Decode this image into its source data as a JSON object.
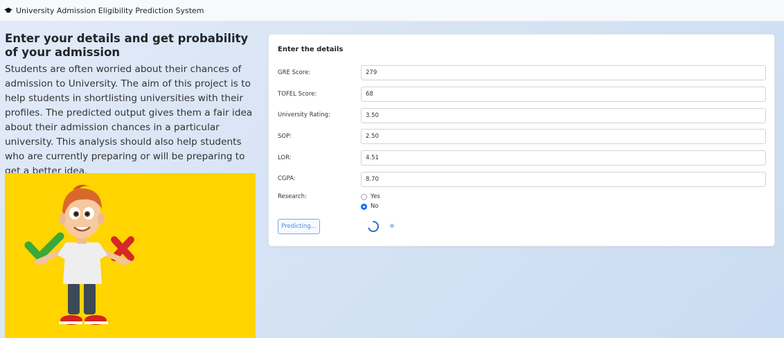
{
  "navbar": {
    "title": "University Admission Eligibility Prediction System",
    "icon": "graduation-cap-icon"
  },
  "intro": {
    "headline": "Enter your details and get probability of your admission",
    "description": "Students are often worried about their chances of admission to University. The aim of this project is to help students in shortlisting universities with their profiles. The predicted output gives them a fair idea about their admission chances in a particular university. This analysis should also help students who are currently preparing or will be preparing to get a better idea."
  },
  "form": {
    "title": "Enter the details",
    "fields": {
      "gre": {
        "label": "GRE Score:",
        "value": "279"
      },
      "tofel": {
        "label": "TOFEL Score:",
        "value": "68"
      },
      "rating": {
        "label": "University Rating:",
        "value": "3.50"
      },
      "sop": {
        "label": "SOP:",
        "value": "2.50"
      },
      "lor": {
        "label": "LOR:",
        "value": "4.51"
      },
      "cgpa": {
        "label": "CGPA:",
        "value": "8.70"
      }
    },
    "research": {
      "label": "Research:",
      "options": [
        "Yes",
        "No"
      ],
      "selected": "No"
    },
    "submit_label": "Predicting..."
  },
  "colors": {
    "accent": "#0d6efd",
    "illustration_bg": "#ffd400",
    "check": "#3aa83a",
    "cross": "#d62828"
  }
}
